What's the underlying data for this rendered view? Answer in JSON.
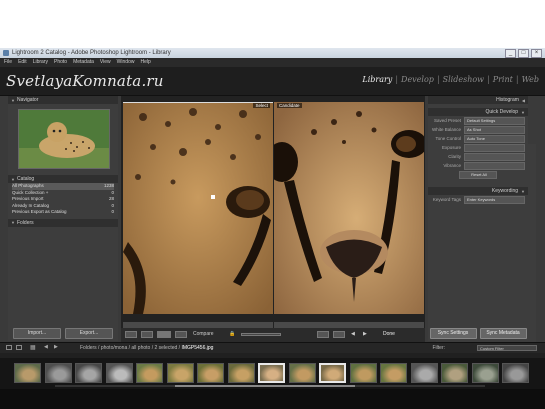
{
  "window": {
    "title": "Lightroom 2 Catalog - Adobe Photoshop Lightroom - Library",
    "controls": [
      "_",
      "□",
      "×"
    ]
  },
  "menu": [
    "File",
    "Edit",
    "Library",
    "Photo",
    "Metadata",
    "View",
    "Window",
    "Help"
  ],
  "logo": "SvetlayaKomnata.ru",
  "modules": [
    {
      "label": "Library",
      "active": true
    },
    {
      "label": "Develop",
      "active": false
    },
    {
      "label": "Slideshow",
      "active": false
    },
    {
      "label": "Print",
      "active": false
    },
    {
      "label": "Web",
      "active": false
    }
  ],
  "left_panel": {
    "navigator": {
      "title": "Navigator",
      "zoom_options": "FIT  FILL  1:1  3:1"
    },
    "catalog": {
      "title": "Catalog",
      "items": [
        {
          "label": "All Photographs",
          "count": "1238",
          "selected": true
        },
        {
          "label": "Quick Collection +",
          "count": "0",
          "selected": false
        },
        {
          "label": "Previous Import",
          "count": "28",
          "selected": false
        },
        {
          "label": "Already In Catalog",
          "count": "0",
          "selected": false
        },
        {
          "label": "Previous Export as Catalog",
          "count": "0",
          "selected": false
        }
      ]
    },
    "folders": {
      "title": "Folders"
    },
    "buttons": {
      "import": "Import...",
      "export": "Export..."
    }
  },
  "center": {
    "left_label": "Select",
    "right_label": "Candidate",
    "toolbar": {
      "compare": "Compare",
      "done": "Done"
    }
  },
  "right_panel": {
    "histogram": "Histogram",
    "quick_develop": {
      "title": "Quick Develop",
      "fields": [
        {
          "label": "Saved Preset",
          "value": "Default Settings"
        },
        {
          "label": "White Balance",
          "value": "As Shot"
        },
        {
          "label": "Tone Control",
          "value": "Auto Tone"
        },
        {
          "label": "Exposure",
          "value": ""
        },
        {
          "label": "Clarity",
          "value": ""
        },
        {
          "label": "Vibrance",
          "value": ""
        }
      ],
      "reset": "Reset All"
    },
    "keywording": {
      "title": "Keywording",
      "field_label": "Keyword Tags",
      "field_value": "Enter Keywords"
    },
    "buttons": {
      "sync_settings": "Sync Settings",
      "sync_metadata": "Sync Metadata"
    }
  },
  "pathbar": {
    "path": "Folders / photo/mona / all photo / 2 selected /",
    "file": "IMGP5456.jpg",
    "filter_label": "Filter:",
    "filter_value": "Custom Filter"
  },
  "filmstrip": {
    "count": 17,
    "selected_indices": [
      8,
      10
    ]
  }
}
